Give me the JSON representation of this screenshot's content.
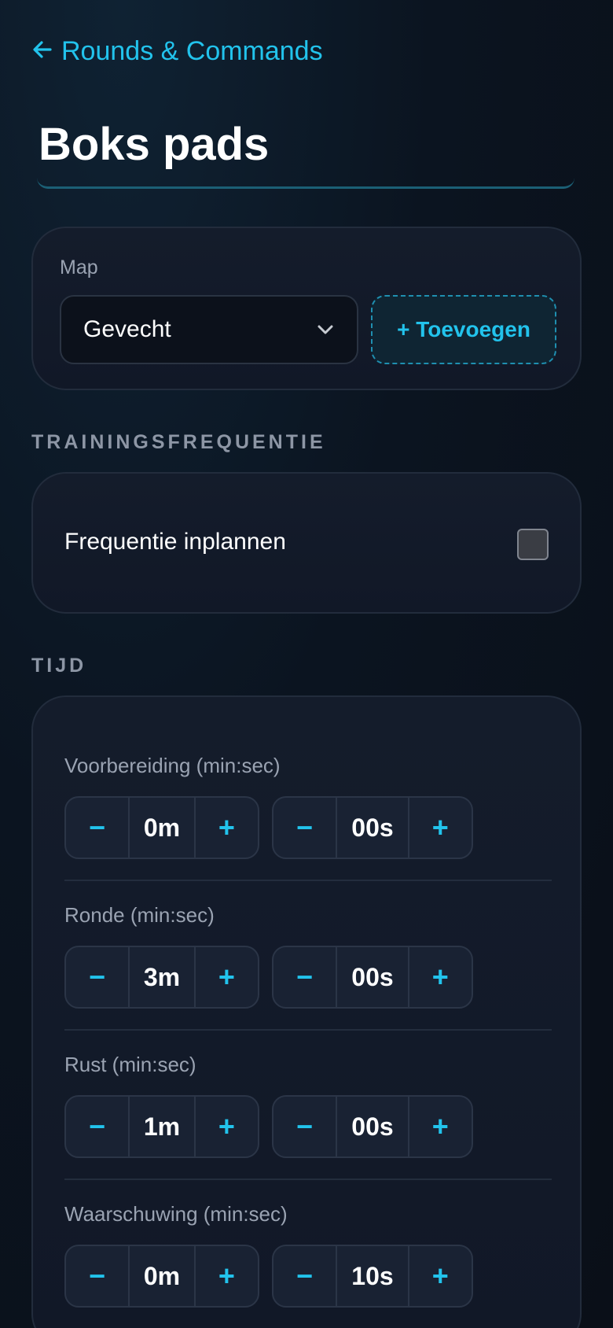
{
  "nav": {
    "back_label": "Rounds & Commands",
    "back_icon": "arrow-left-icon"
  },
  "title": "Boks pads",
  "map": {
    "label": "Map",
    "selected": "Gevecht",
    "add_label": "+ Toevoegen"
  },
  "frequency": {
    "section": "TRAININGSFREQUENTIE",
    "toggle_label": "Frequentie inplannen",
    "checked": false
  },
  "time": {
    "section": "TIJD",
    "rows": [
      {
        "label": "Voorbereiding (min:sec)",
        "minutes": "0m",
        "seconds": "00s"
      },
      {
        "label": "Ronde (min:sec)",
        "minutes": "3m",
        "seconds": "00s"
      },
      {
        "label": "Rust (min:sec)",
        "minutes": "1m",
        "seconds": "00s"
      },
      {
        "label": "Waarschuwing (min:sec)",
        "minutes": "0m",
        "seconds": "10s"
      }
    ],
    "minus": "−",
    "plus": "+"
  },
  "colors": {
    "accent": "#22c3ec",
    "background": "#0b1420",
    "card": "#141c2b"
  }
}
